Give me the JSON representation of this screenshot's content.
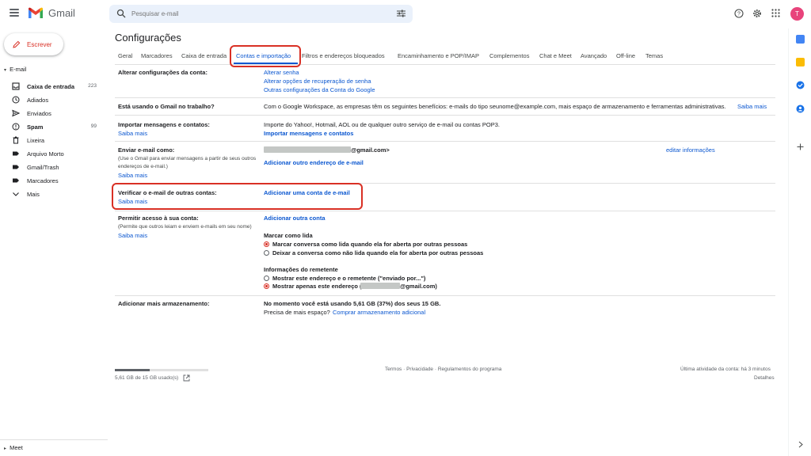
{
  "header": {
    "app_name": "Gmail",
    "search_placeholder": "Pesquisar e-mail",
    "avatar_letter": "T",
    "avatar_color": "#e8437b"
  },
  "nav": {
    "compose_label": "Escrever",
    "section_label": "E-mail",
    "items": [
      {
        "label": "Caixa de entrada",
        "count": "223",
        "icon": "inbox-icon"
      },
      {
        "label": "Adiados",
        "count": "",
        "icon": "clock-icon"
      },
      {
        "label": "Enviados",
        "count": "",
        "icon": "send-icon"
      },
      {
        "label": "Spam",
        "count": "99",
        "icon": "spam-icon"
      },
      {
        "label": "Lixeira",
        "count": "",
        "icon": "trash-icon"
      },
      {
        "label": "Arquivo Morto",
        "count": "",
        "icon": "label-icon"
      },
      {
        "label": "Gmail/Trash",
        "count": "",
        "icon": "label-icon"
      },
      {
        "label": "Marcadores",
        "count": "",
        "icon": "label-icon"
      },
      {
        "label": "Mais",
        "count": "",
        "icon": "chevron-down-icon"
      }
    ],
    "meet_label": "Meet"
  },
  "settings": {
    "title": "Configurações",
    "tabs": [
      "Geral",
      "Marcadores",
      "Caixa de entrada",
      "Contas e importação",
      "Filtros e endereços bloqueados",
      "Encaminhamento e POP/IMAP",
      "Complementos",
      "Chat e Meet",
      "Avançado",
      "Off-line",
      "Temas"
    ],
    "active_tab": "Contas e importação",
    "rows": {
      "change_account": {
        "label": "Alterar configurações da conta:",
        "links": [
          "Alterar senha",
          "Alterar opções de recuperação de senha",
          "Outras configurações da Conta do Google"
        ]
      },
      "work": {
        "label": "Está usando o Gmail no trabalho?",
        "text": "Com o Google Workspace, as empresas têm os seguintes benefícios: e-mails do tipo seunome@example.com, mais espaço de armazenamento e ferramentas administrativas.",
        "link": "Saiba mais"
      },
      "import": {
        "label": "Importar mensagens e contatos:",
        "learn_more": "Saiba mais",
        "text": "Importe do Yahoo!, Hotmail, AOL ou de qualquer outro serviço de e-mail ou contas POP3.",
        "link": "Importar mensagens e contatos"
      },
      "send_as": {
        "label": "Enviar e-mail como:",
        "sub": "(Use o Gmail para enviar mensagens a partir de seus outros endereços de e-mail.)",
        "learn_more": "Saiba mais",
        "email_suffix": "@gmail.com>",
        "add_link": "Adicionar outro endereço de e-mail",
        "edit_link": "editar informações"
      },
      "check_mail": {
        "label": "Verificar o e-mail de outras contas:",
        "learn_more": "Saiba mais",
        "link": "Adicionar uma conta de e-mail"
      },
      "grant_access": {
        "label": "Permitir acesso à sua conta:",
        "sub": "(Permite que outros leiam e enviem e-mails em seu nome)",
        "learn_more": "Saiba mais",
        "link": "Adicionar outra conta",
        "mark_read_title": "Marcar como lida",
        "mark_read_options": [
          "Marcar conversa como lida quando ela for aberta por outras pessoas",
          "Deixar a conversa como não lida quando ela for aberta por outras pessoas"
        ],
        "sender_info_title": "Informações do remetente",
        "sender_info_options": [
          "Mostrar este endereço e o remetente (\"enviado por...\")",
          "Mostrar apenas este endereço ("
        ],
        "sender_info_suffix": "@gmail.com)"
      },
      "storage": {
        "label": "Adicionar mais armazenamento:",
        "text": "No momento você está usando 5,61 GB (37%) dos seus 15 GB.",
        "text2": "Precisa de mais espaço?",
        "link": "Comprar armazenamento adicional"
      }
    }
  },
  "footer": {
    "storage_used": "5,61 GB de 15 GB usado(s)",
    "storage_fraction": 0.37,
    "links": "Termos · Privacidade · Regulamentos do programa",
    "last_activity": "Última atividade da conta: há 3 minutos",
    "details": "Detalhes"
  }
}
